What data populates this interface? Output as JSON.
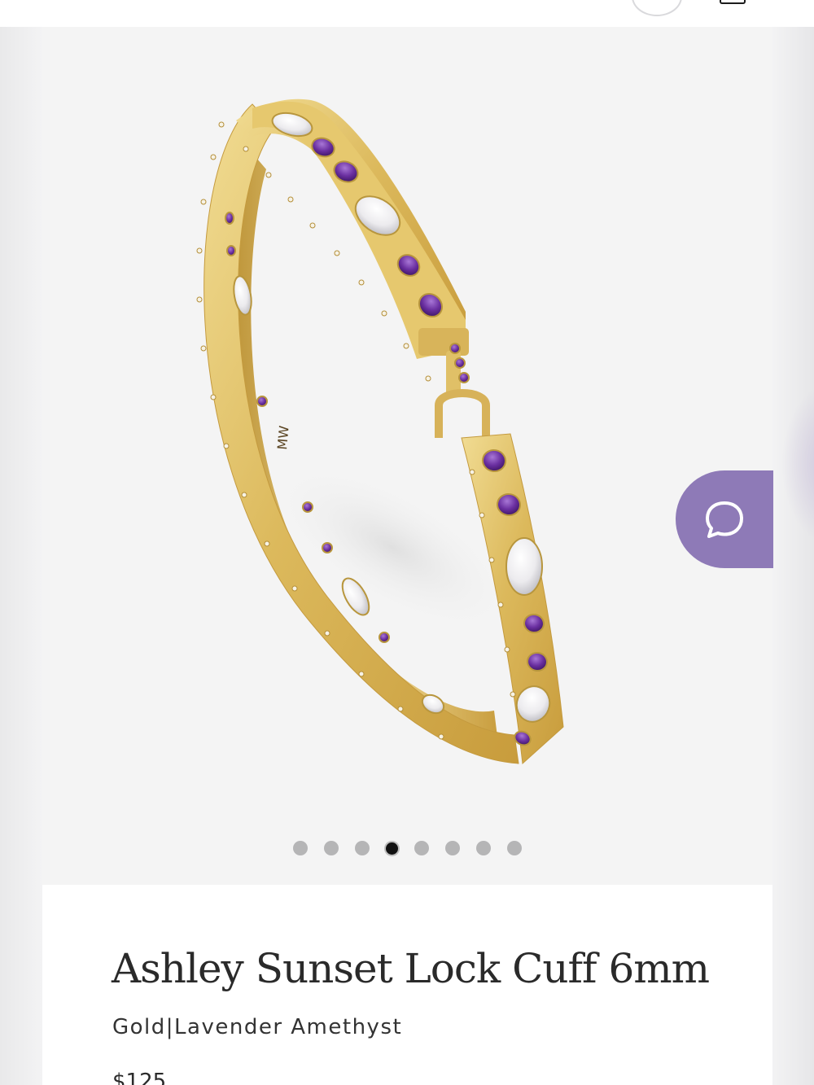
{
  "header": {
    "account_icon": "user-circle-icon",
    "bag_icon": "shopping-bag-icon"
  },
  "gallery": {
    "image_alt": "Ashley Sunset Lock Cuff 6mm",
    "slide_count": 8,
    "active_slide": 4,
    "background_color": "#f4f4f4"
  },
  "chat": {
    "icon": "chat-bubble-icon",
    "color": "#8e7ab7"
  },
  "product": {
    "title": "Ashley Sunset Lock Cuff 6mm",
    "variant": "Gold|Lavender Amethyst",
    "price": "$125"
  },
  "colors": {
    "gold": "#e3c468",
    "amethyst": "#6a2fa0",
    "accent": "#8e7ab7"
  }
}
